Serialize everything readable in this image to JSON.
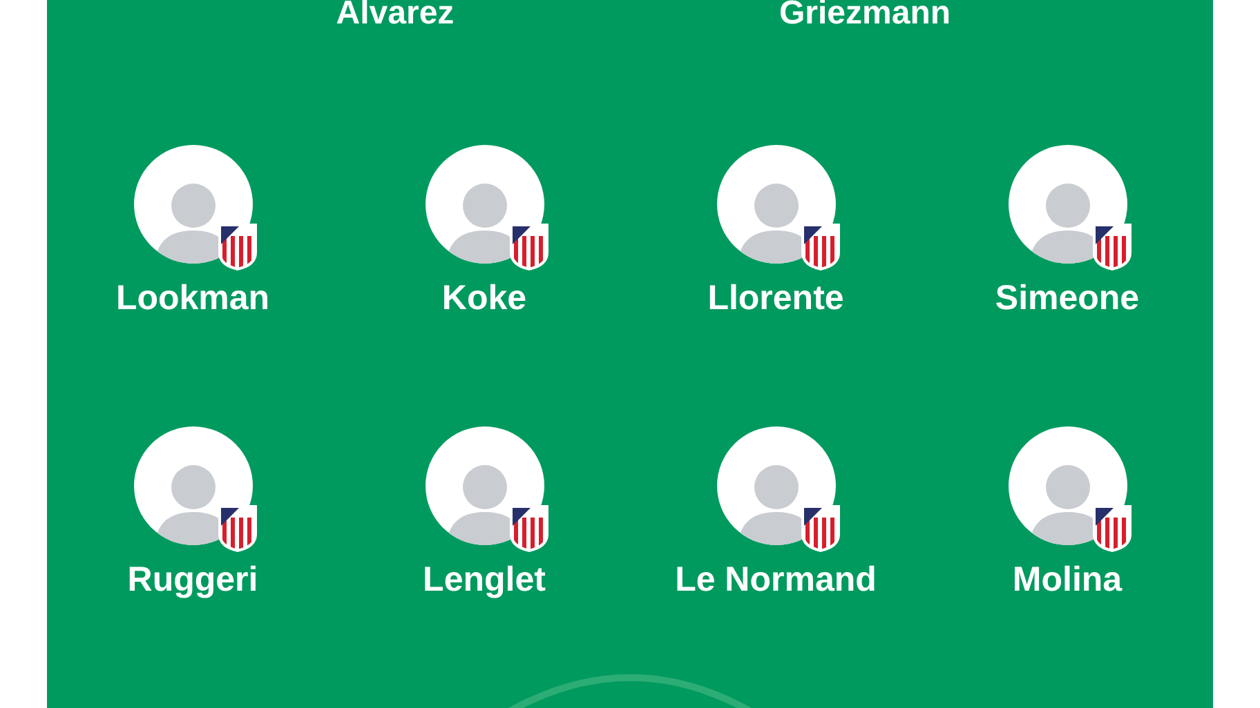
{
  "forwards": [
    {
      "name": "Alvarez"
    },
    {
      "name": "Griezmann"
    }
  ],
  "lines": [
    {
      "players": [
        {
          "name": "Lookman"
        },
        {
          "name": "Koke"
        },
        {
          "name": "Llorente"
        },
        {
          "name": "Simeone"
        }
      ]
    },
    {
      "players": [
        {
          "name": "Ruggeri"
        },
        {
          "name": "Lenglet"
        },
        {
          "name": "Le Normand"
        },
        {
          "name": "Molina"
        }
      ]
    }
  ]
}
